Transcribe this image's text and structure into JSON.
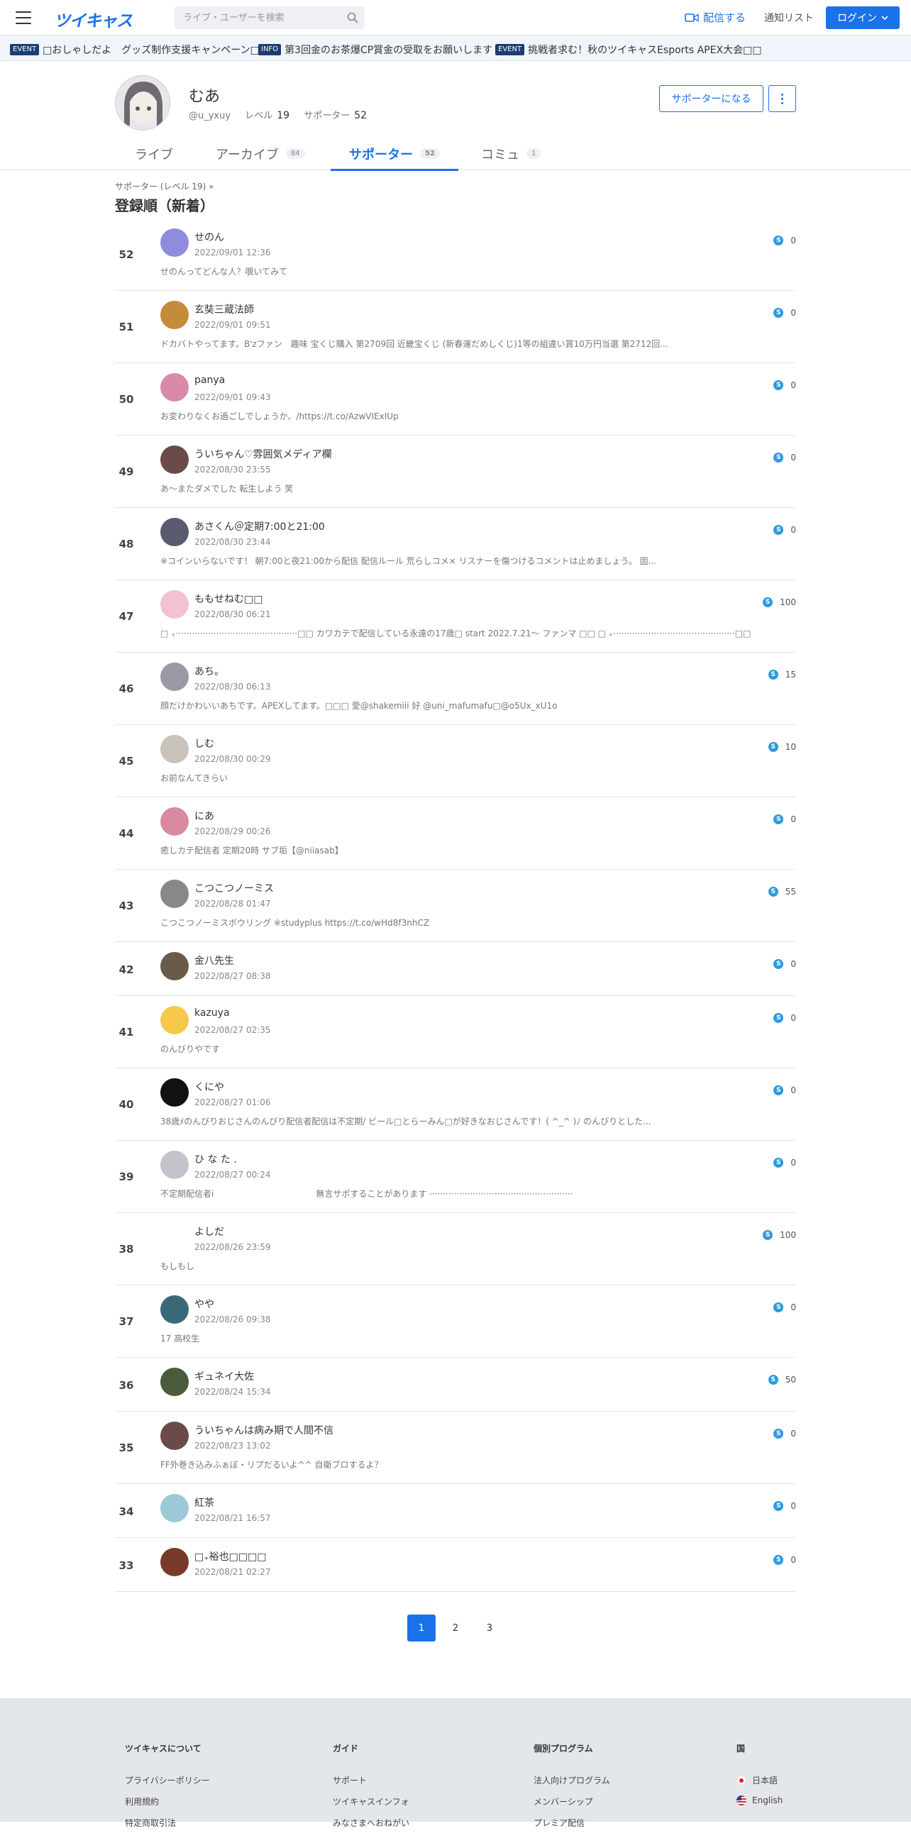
{
  "header": {
    "logo": "ツイキャス",
    "search_placeholder": "ライブ・ユーザーを検索",
    "broadcast": "配信する",
    "notify": "通知リスト",
    "login": "ログイン"
  },
  "ticker": [
    {
      "tag": "EVENT",
      "text": "□おしゃしだよ　グッズ制作支援キャンペーン□"
    },
    {
      "tag": "INFO",
      "text": "第3回金のお茶爆CP賞金の受取をお願いします"
    },
    {
      "tag": "EVENT",
      "text": "挑戦者求む！秋のツイキャスEsports APEX大会□□"
    }
  ],
  "profile": {
    "name": "むあ",
    "handle": "@u_yxuy",
    "level_label": "レベル",
    "level": "19",
    "supporter_label": "サポーター",
    "supporter_count": "52",
    "become_supporter": "サポーターになる"
  },
  "tabs": [
    {
      "label": "ライブ",
      "count": ""
    },
    {
      "label": "アーカイブ",
      "count": "84"
    },
    {
      "label": "サポーター",
      "count": "52"
    },
    {
      "label": "コミュ",
      "count": "1"
    }
  ],
  "section": {
    "breadcrumb": "サポーター (レベル 19)  »",
    "title": "登録順（新着）"
  },
  "supporters": [
    {
      "rank": "52",
      "name": "せのん",
      "date": "2022/09/01 12:36",
      "bio": "せのんってどんな人？覗いてみて",
      "points": "0",
      "color": "#8f8cde"
    },
    {
      "rank": "51",
      "name": "玄奘三蔵法師",
      "date": "2022/09/01 09:51",
      "bio": "ドカバトやってます。B'zファン　趣味 宝くじ購入 第2709回 近畿宝くじ (新春運だめしくじ)1等の組違い賞10万円当選 第2712回...",
      "points": "0",
      "color": "#c58a3a"
    },
    {
      "rank": "50",
      "name": "panya",
      "date": "2022/09/01 09:43",
      "bio": "お変わりなくお過ごしでしょうか、/https://t.co/AzwVIExIUp",
      "points": "0",
      "color": "#d98aa8"
    },
    {
      "rank": "49",
      "name": "ういちゃん♡雰囲気メディア欄",
      "date": "2022/08/30 23:55",
      "bio": "あ〜またダメでした 転生しよう 笑",
      "points": "0",
      "color": "#6b4a4a"
    },
    {
      "rank": "48",
      "name": "あさくん＠定期7:00と21:00",
      "date": "2022/08/30 23:44",
      "bio": "※コインいらないです！ 朝7:00と夜21:00から配信 配信ルール 荒らしコメ× リスナーを傷つけるコメントは止めましょう。 固...",
      "points": "0",
      "color": "#5a5a70"
    },
    {
      "rank": "47",
      "name": "ももせねむ□□",
      "date": "2022/08/30 06:21",
      "bio": "□ ₊·············································□□ カワカテで配信している永遠の17歳□ start 2022.7.21〜 ファンマ □□ □ ₊·············································□□",
      "points": "100",
      "color": "#f2c2d0"
    },
    {
      "rank": "46",
      "name": "あち。",
      "date": "2022/08/30 06:13",
      "bio": "顔だけかわいいあちです。APEXしてます。□□□ 愛@shakemiii 好 @uni_mafumafu□@o5Ux_xU1o",
      "points": "15",
      "color": "#9a9aa4"
    },
    {
      "rank": "45",
      "name": "しむ",
      "date": "2022/08/30 00:29",
      "bio": "お前なんてきらい",
      "points": "10",
      "color": "#c8c2ba"
    },
    {
      "rank": "44",
      "name": "にあ",
      "date": "2022/08/29 00:26",
      "bio": "癒しカテ配信者 定期20時 サブ垢【@niiasab】",
      "points": "0",
      "color": "#d88aa0"
    },
    {
      "rank": "43",
      "name": "こつこつノーミス",
      "date": "2022/08/28 01:47",
      "bio": "こつこつノーミスボウリング ※studyplus https://t.co/wHd8f3nhCZ",
      "points": "55",
      "color": "#888"
    },
    {
      "rank": "42",
      "name": "金八先生",
      "date": "2022/08/27 08:38",
      "bio": "",
      "points": "0",
      "color": "#6a5a4a"
    },
    {
      "rank": "41",
      "name": "kazuya",
      "date": "2022/08/27 02:35",
      "bio": "のんびりやです",
      "points": "0",
      "color": "#f6c84c"
    },
    {
      "rank": "40",
      "name": "くにや",
      "date": "2022/08/27 01:06",
      "bio": "38歳ﾒのんびりおじさんのんびり配信者配信は不定期/ ビール□とらーみん□が好きなおじさんです！( ^_^ )ﾉ のんびりとした...",
      "points": "0",
      "color": "#111"
    },
    {
      "rank": "39",
      "name": "ひ な た .",
      "date": "2022/08/27 00:24",
      "bio": "不定期配信者i　　　　　　　　　　　　無言サポすることがあります ·····················································",
      "points": "0",
      "color": "#c6c2cc"
    },
    {
      "rank": "38",
      "name": "よしだ",
      "date": "2022/08/26 23:59",
      "bio": "もしもし",
      "points": "100",
      "color": "#ffffff"
    },
    {
      "rank": "37",
      "name": "やや",
      "date": "2022/08/26 09:38",
      "bio": "17 高校生",
      "points": "0",
      "color": "#3a6a7a"
    },
    {
      "rank": "36",
      "name": "ギュネイ大佐",
      "date": "2022/08/24 15:34",
      "bio": "",
      "points": "50",
      "color": "#4a5a3a"
    },
    {
      "rank": "35",
      "name": "ういちゃんは病み期で人間不信",
      "date": "2022/08/23 13:02",
      "bio": "FF外巻き込みふぁぼ・リプだるいよ^^ 自衛ブロするよ？",
      "points": "0",
      "color": "#6b4a4a"
    },
    {
      "rank": "34",
      "name": "紅茶",
      "date": "2022/08/21 16:57",
      "bio": "",
      "points": "0",
      "color": "#9cc8d8"
    },
    {
      "rank": "33",
      "name": "□₊裕也□□□□",
      "date": "2022/08/21 02:27",
      "bio": "",
      "points": "0",
      "color": "#7a3a2a"
    }
  ],
  "pagination": [
    "1",
    "2",
    "3"
  ],
  "footer": [
    {
      "heading": "ツイキャスについて",
      "links": [
        "プライバシーポリシー",
        "利用規約",
        "特定商取引法"
      ]
    },
    {
      "heading": "ガイド",
      "links": [
        "サポート",
        "ツイキャスインフォ",
        "みなさまへおねがい"
      ]
    },
    {
      "heading": "個別プログラム",
      "links": [
        "法人向けプログラム",
        "メンバーシップ",
        "プレミア配信"
      ]
    },
    {
      "heading": "国",
      "links": [
        "日本語",
        "English"
      ]
    }
  ],
  "colors": {
    "accent": "#1a72e8",
    "coin": "#2e9be0",
    "footer_bg": "#e3e6ea"
  }
}
